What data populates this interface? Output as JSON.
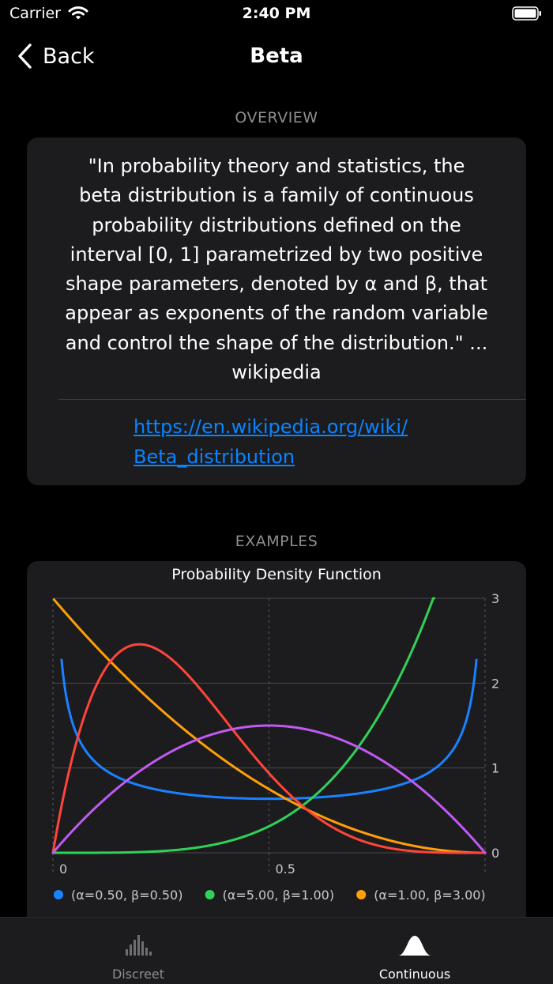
{
  "status": {
    "carrier": "Carrier",
    "time": "2:40 PM"
  },
  "nav": {
    "back_label": "Back",
    "title": "Beta"
  },
  "overview": {
    "header": "OVERVIEW",
    "quote_lines": [
      "\"In probability theory and statistics, the",
      "beta distribution is a family of continuous",
      "probability distributions defined on the",
      "interval [0, 1] parametrized by two positive",
      "shape parameters, denoted by α and β, that",
      "appear as exponents of the random variable",
      "and control the shape of the distribution.\" ...",
      "wikipedia"
    ],
    "link_lines": [
      "https://en.wikipedia.org/wiki/",
      "Beta_distribution"
    ]
  },
  "examples": {
    "header": "EXAMPLES"
  },
  "chart_data": {
    "type": "line",
    "title": "Probability Density Function",
    "x_ticks": [
      "0",
      "0.5"
    ],
    "y_ticks": [
      "0",
      "1",
      "2",
      "3"
    ],
    "xlim": [
      0,
      1
    ],
    "ylim": [
      0,
      3
    ],
    "grid": true,
    "legend_position": "bottom",
    "series": [
      {
        "name": "(α=0.50, β=0.50)",
        "alpha": 0.5,
        "beta": 0.5,
        "color": "#1a82ff"
      },
      {
        "name": "(α=5.00, β=1.00)",
        "alpha": 5,
        "beta": 1,
        "color": "#30d158"
      },
      {
        "name": "(α=1.00, β=3.00)",
        "alpha": 1,
        "beta": 3,
        "color": "#ff9f0a"
      },
      {
        "name": "",
        "alpha": 2,
        "beta": 5,
        "color": "#ff453a"
      },
      {
        "name": "",
        "alpha": 2,
        "beta": 2,
        "color": "#bf5af2"
      }
    ]
  },
  "tabs": [
    {
      "label": "Discreet",
      "icon": "bar-chart-icon",
      "selected": false
    },
    {
      "label": "Continuous",
      "icon": "bell-curve-icon",
      "selected": true
    }
  ],
  "colors": {
    "background": "#000000",
    "card": "#1c1c1e",
    "link": "#0a84ff",
    "secondary_text": "#8e8e93"
  }
}
